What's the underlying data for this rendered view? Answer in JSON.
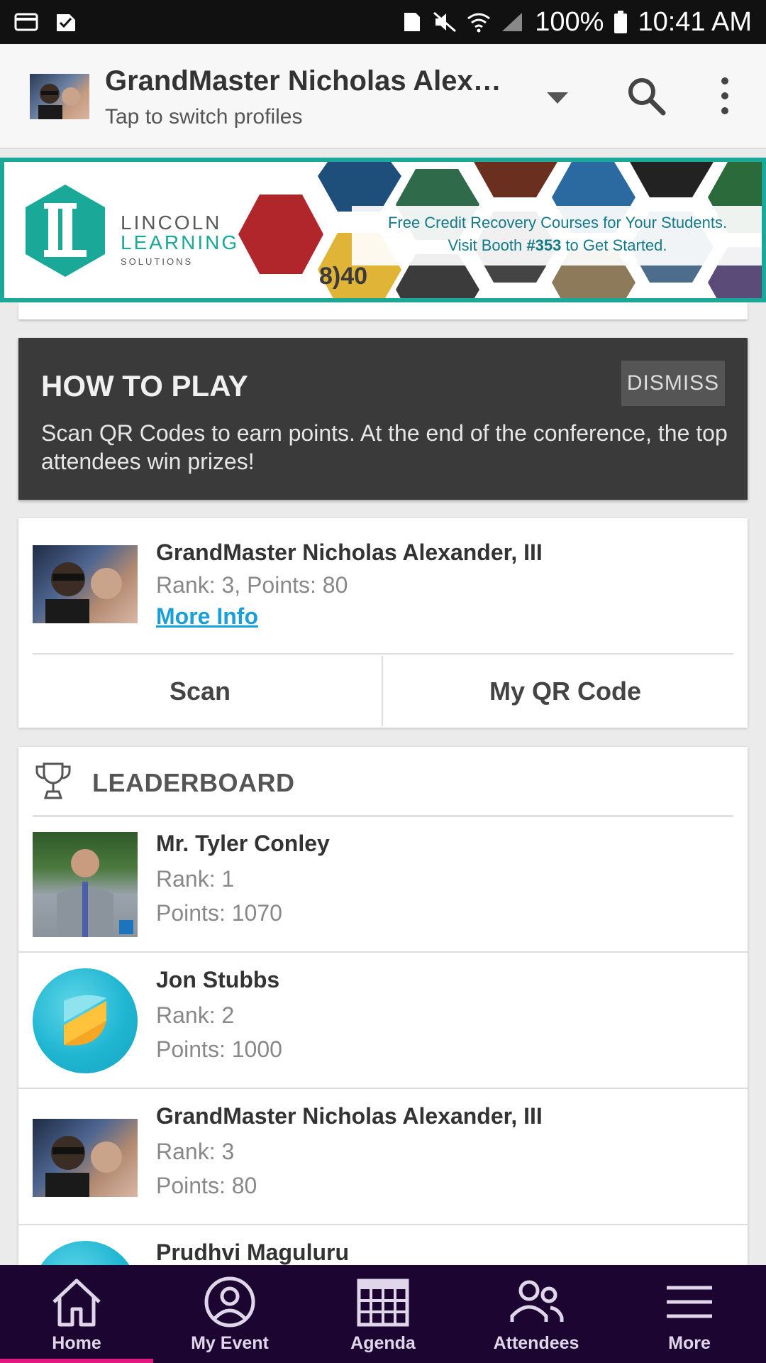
{
  "status_bar": {
    "battery": "100%",
    "time": "10:41 AM"
  },
  "app_bar": {
    "profile_name": "GrandMaster Nicholas Alexa…",
    "subtitle": "Tap to switch profiles"
  },
  "banner": {
    "brand_line1": "LINCOLN",
    "brand_line2": "LEARNING",
    "brand_line3": "SOLUTIONS",
    "caption_line1": "Free Credit Recovery Courses for Your Students.",
    "caption_line2_pre": "Visit Booth ",
    "caption_line2_booth": "#353",
    "caption_line2_post": " to Get Started.",
    "math_text": "8)40"
  },
  "how_to_play": {
    "title": "HOW TO PLAY",
    "dismiss_label": "DISMISS",
    "body": "Scan QR Codes to earn points. At the end of the conference, the top attendees win prizes!"
  },
  "my_card": {
    "name": "GrandMaster Nicholas Alexander, III",
    "rank_points": "Rank: 3, Points: 80",
    "more_info_label": "More Info",
    "scan_label": "Scan",
    "qr_label": "My QR Code"
  },
  "leaderboard": {
    "title": "LEADERBOARD",
    "entries": [
      {
        "name": "Mr. Tyler Conley",
        "rank": "Rank: 1",
        "points": "Points: 1070"
      },
      {
        "name": "Jon Stubbs",
        "rank": "Rank: 2",
        "points": "Points: 1000"
      },
      {
        "name": "GrandMaster Nicholas Alexander, III",
        "rank": "Rank: 3",
        "points": "Points: 80"
      },
      {
        "name": "Prudhvi Maguluru",
        "rank": "",
        "points": ""
      }
    ]
  },
  "bottom_nav": {
    "items": [
      {
        "label": "Home",
        "icon": "home-icon"
      },
      {
        "label": "My Event",
        "icon": "person-circle-icon"
      },
      {
        "label": "Agenda",
        "icon": "calendar-icon"
      },
      {
        "label": "Attendees",
        "icon": "people-icon"
      },
      {
        "label": "More",
        "icon": "menu-icon"
      }
    ],
    "active": "Home"
  },
  "colors": {
    "accent_teal": "#1aa898",
    "link_blue": "#1a9fd9",
    "nav_background": "#1c0530",
    "nav_active": "#e0187f"
  }
}
